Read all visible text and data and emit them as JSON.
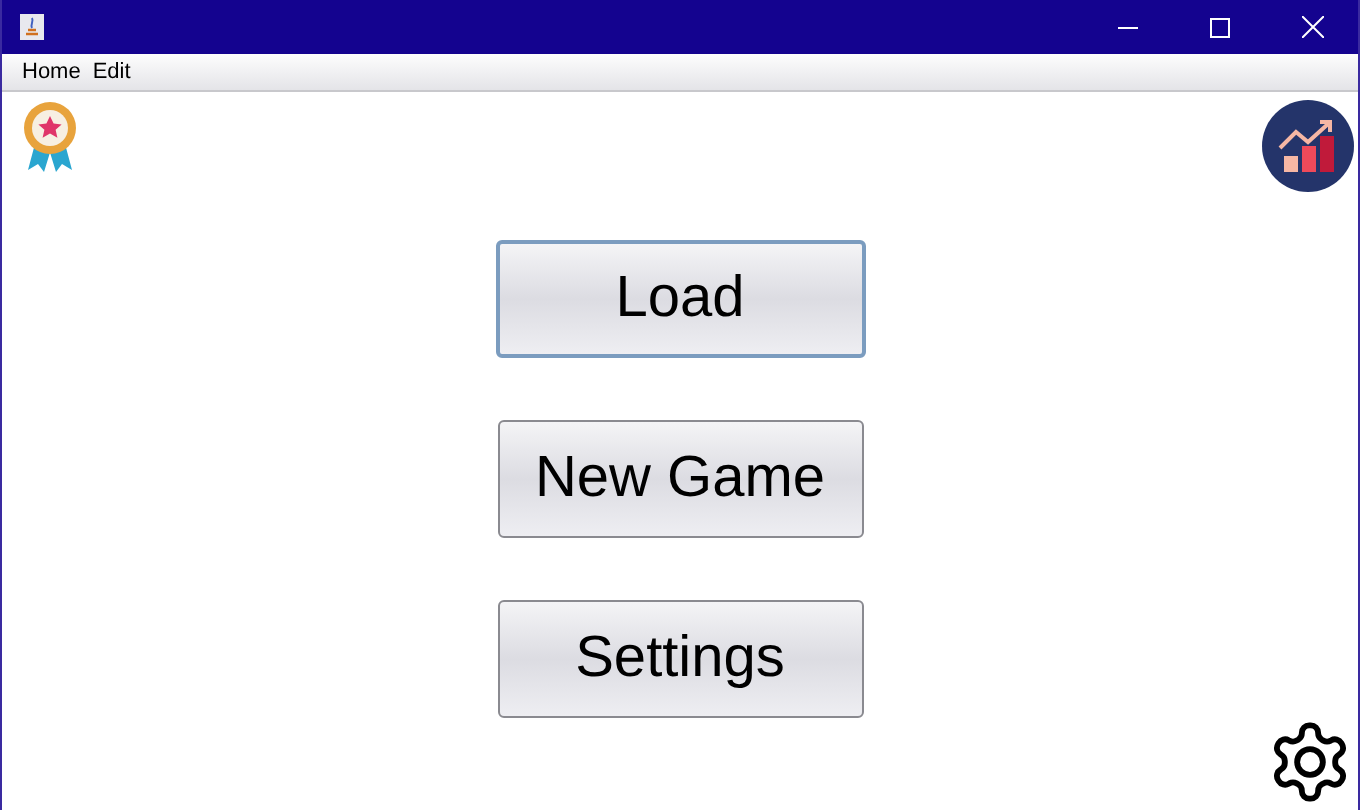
{
  "menu": [
    "Home",
    "Edit"
  ],
  "buttons": [
    {
      "label": "Load",
      "focused": true
    },
    {
      "label": "New Game",
      "focused": false
    },
    {
      "label": "Settings",
      "focused": false
    }
  ]
}
